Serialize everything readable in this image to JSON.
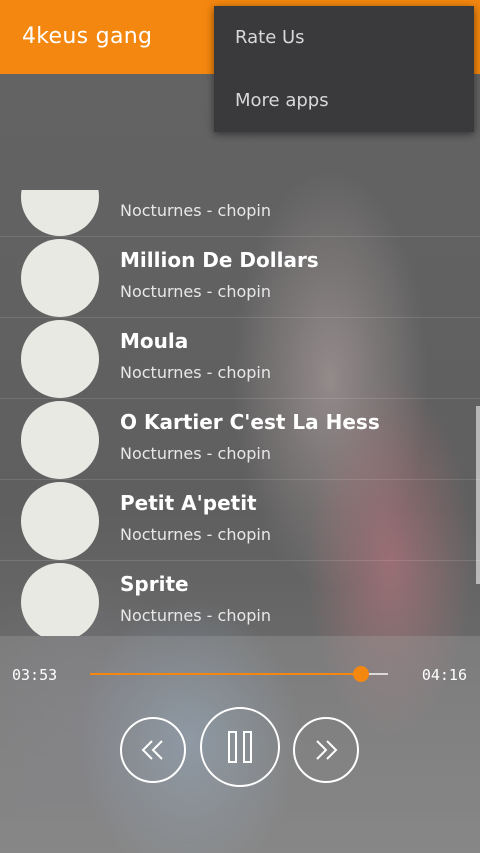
{
  "app": {
    "title": "4keus gang",
    "accent": "#f4870f"
  },
  "menu": {
    "items": [
      "Rate Us",
      "More apps"
    ]
  },
  "songs": [
    {
      "title": "",
      "artist": "Nocturnes - chopin"
    },
    {
      "title": "Million De Dollars",
      "artist": "Nocturnes - chopin"
    },
    {
      "title": "Moula",
      "artist": "Nocturnes - chopin"
    },
    {
      "title": "O Kartier C'est La Hess",
      "artist": "Nocturnes - chopin"
    },
    {
      "title": "Petit A'petit",
      "artist": "Nocturnes - chopin"
    },
    {
      "title": "Sprite",
      "artist": "Nocturnes - chopin"
    }
  ],
  "player": {
    "current_time": "03:53",
    "total_time": "04:16",
    "progress": 0.91,
    "prev_icon": "rewind-icon",
    "play_icon": "pause-icon",
    "next_icon": "fast-forward-icon"
  }
}
